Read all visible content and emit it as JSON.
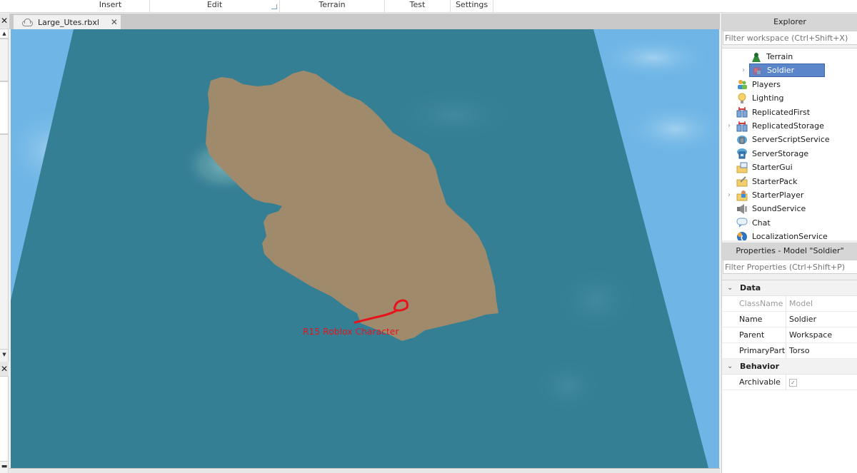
{
  "ribbon": {
    "tabs": [
      {
        "label": "Insert"
      },
      {
        "label": "Edit"
      },
      {
        "label": "Terrain"
      },
      {
        "label": "Test"
      },
      {
        "label": "Settings"
      }
    ]
  },
  "document": {
    "tab_title": "Large_Utes.rbxl",
    "close_glyph": "✕",
    "tab_icon": "cloud-icon"
  },
  "viewport": {
    "annotation_text": "R15 Roblox Character",
    "annotation_color": "#e8131a",
    "colors": {
      "sky": "#6fb6e6",
      "water": "#357f95",
      "land": "#a08a6c"
    }
  },
  "explorer": {
    "title": "Explorer",
    "filter_placeholder": "Filter workspace (Ctrl+Shift+X)",
    "items": [
      {
        "label": "Terrain",
        "icon": "terrain-icon",
        "expandable": false,
        "selected": false,
        "indent": 1
      },
      {
        "label": "Soldier",
        "icon": "model-icon",
        "expandable": true,
        "selected": true,
        "indent": 1
      },
      {
        "label": "Players",
        "icon": "players-icon",
        "expandable": false,
        "selected": false,
        "indent": 0
      },
      {
        "label": "Lighting",
        "icon": "lightbulb-icon",
        "expandable": false,
        "selected": false,
        "indent": 0
      },
      {
        "label": "ReplicatedFirst",
        "icon": "replicated-first-icon",
        "expandable": false,
        "selected": false,
        "indent": 0
      },
      {
        "label": "ReplicatedStorage",
        "icon": "replicated-storage-icon",
        "expandable": true,
        "selected": false,
        "indent": 0
      },
      {
        "label": "ServerScriptService",
        "icon": "server-script-service-icon",
        "expandable": false,
        "selected": false,
        "indent": 0
      },
      {
        "label": "ServerStorage",
        "icon": "server-storage-icon",
        "expandable": false,
        "selected": false,
        "indent": 0
      },
      {
        "label": "StarterGui",
        "icon": "starter-gui-icon",
        "expandable": false,
        "selected": false,
        "indent": 0
      },
      {
        "label": "StarterPack",
        "icon": "starter-pack-icon",
        "expandable": false,
        "selected": false,
        "indent": 0
      },
      {
        "label": "StarterPlayer",
        "icon": "starter-player-icon",
        "expandable": true,
        "selected": false,
        "indent": 0
      },
      {
        "label": "SoundService",
        "icon": "speaker-icon",
        "expandable": false,
        "selected": false,
        "indent": 0
      },
      {
        "label": "Chat",
        "icon": "chat-bubble-icon",
        "expandable": false,
        "selected": false,
        "indent": 0
      },
      {
        "label": "LocalizationService",
        "icon": "globe-icon",
        "expandable": false,
        "selected": false,
        "indent": 0
      }
    ]
  },
  "properties": {
    "title": "Properties - Model \"Soldier\"",
    "filter_placeholder": "Filter Properties (Ctrl+Shift+P)",
    "categories": [
      {
        "name": "Data",
        "rows": [
          {
            "key": "ClassName",
            "value": "Model",
            "readonly": true
          },
          {
            "key": "Name",
            "value": "Soldier",
            "readonly": false
          },
          {
            "key": "Parent",
            "value": "Workspace",
            "readonly": false
          },
          {
            "key": "PrimaryPart",
            "value": "Torso",
            "readonly": false
          }
        ]
      },
      {
        "name": "Behavior",
        "rows": [
          {
            "key": "Archivable",
            "value": "",
            "checkbox": true,
            "checked": true
          }
        ]
      }
    ],
    "check_glyph": "✓",
    "chevron_glyph": "⌄"
  }
}
